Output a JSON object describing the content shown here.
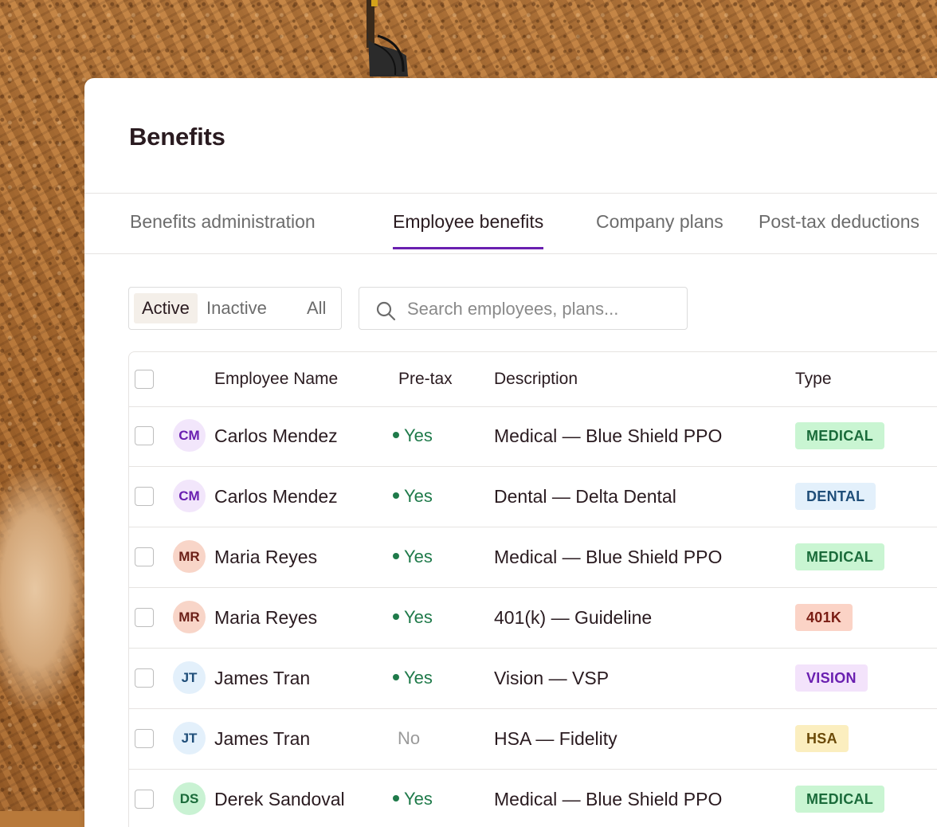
{
  "page": {
    "title": "Benefits"
  },
  "tabs": [
    {
      "label": "Benefits administration",
      "active": false
    },
    {
      "label": "Employee benefits",
      "active": true
    },
    {
      "label": "Company plans",
      "active": false
    },
    {
      "label": "Post-tax deductions",
      "active": false
    }
  ],
  "filter": {
    "options": [
      "Active",
      "Inactive",
      "All"
    ],
    "selected": "Active"
  },
  "search": {
    "placeholder": "Search employees, plans...",
    "value": ""
  },
  "table": {
    "headers": {
      "name": "Employee Name",
      "pretax": "Pre-tax",
      "description": "Description",
      "type": "Type"
    },
    "rows": [
      {
        "initials": "CM",
        "name": "Carlos Mendez",
        "pretax": "Yes",
        "description": "Medical — Blue Shield PPO",
        "type": "MEDICAL"
      },
      {
        "initials": "CM",
        "name": "Carlos Mendez",
        "pretax": "Yes",
        "description": "Dental — Delta Dental",
        "type": "DENTAL"
      },
      {
        "initials": "MR",
        "name": "Maria Reyes",
        "pretax": "Yes",
        "description": "Medical — Blue Shield PPO",
        "type": "MEDICAL"
      },
      {
        "initials": "MR",
        "name": "Maria Reyes",
        "pretax": "Yes",
        "description": "401(k) — Guideline",
        "type": "401K"
      },
      {
        "initials": "JT",
        "name": "James Tran",
        "pretax": "Yes",
        "description": "Vision — VSP",
        "type": "VISION"
      },
      {
        "initials": "JT",
        "name": "James Tran",
        "pretax": "No",
        "description": "HSA — Fidelity",
        "type": "HSA"
      },
      {
        "initials": "DS",
        "name": "Derek Sandoval",
        "pretax": "Yes",
        "description": "Medical — Blue Shield PPO",
        "type": "MEDICAL"
      }
    ]
  },
  "colors": {
    "accent": "#6a1fb0",
    "yes": "#1f7a4a",
    "avatar_CM": {
      "bg": "#f2e6fb",
      "fg": "#6a1fb0"
    },
    "avatar_MR": {
      "bg": "#f8d5c8",
      "fg": "#6b1f17"
    },
    "avatar_JT": {
      "bg": "#e3f0fb",
      "fg": "#1f4e79"
    },
    "avatar_DS": {
      "bg": "#c9f2d3",
      "fg": "#1a6b3a"
    },
    "badge_MEDICAL": {
      "bg": "#c9f5d2",
      "fg": "#1a6b3a"
    },
    "badge_DENTAL": {
      "bg": "#e3f0fb",
      "fg": "#1f4e79"
    },
    "badge_401K": {
      "bg": "#fbd3c6",
      "fg": "#7a1d14"
    },
    "badge_VISION": {
      "bg": "#f3e3fb",
      "fg": "#6a1fb0"
    },
    "badge_HSA": {
      "bg": "#fbeebf",
      "fg": "#6b4a08"
    }
  }
}
